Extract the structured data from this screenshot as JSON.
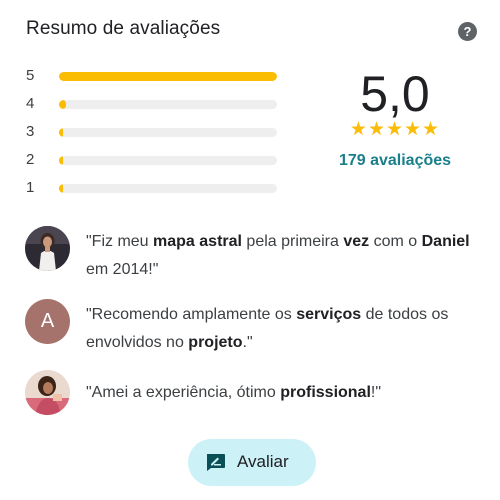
{
  "header": {
    "title": "Resumo de avaliações",
    "help_icon": "help-circle-icon",
    "help_glyph": "?"
  },
  "rating_distribution": {
    "bar_color": "#fbbc04",
    "track_color": "#eeeeef",
    "rows": [
      {
        "stars": "5",
        "fraction": 1.0
      },
      {
        "stars": "4",
        "fraction": 0.03
      },
      {
        "stars": "3",
        "fraction": 0.01
      },
      {
        "stars": "2",
        "fraction": 0.01
      },
      {
        "stars": "1",
        "fraction": 0.01
      }
    ]
  },
  "summary": {
    "score": "5,0",
    "stars": "★★★★★",
    "star_rating": 5,
    "review_count_label": "179 avaliações",
    "link_color": "#1a7f8a"
  },
  "reviews": [
    {
      "avatar": "photo",
      "quote": [
        {
          "text": "\"Fiz meu ",
          "bold": false
        },
        {
          "text": "mapa astral",
          "bold": true
        },
        {
          "text": " pela primeira ",
          "bold": false
        },
        {
          "text": "vez",
          "bold": true
        },
        {
          "text": " com o ",
          "bold": false
        },
        {
          "text": "Daniel",
          "bold": true
        },
        {
          "text": " em 2014!\"",
          "bold": false
        }
      ]
    },
    {
      "avatar": "letter",
      "avatar_letter": "A",
      "avatar_color": "#a5736b",
      "quote": [
        {
          "text": "\"Recomendo amplamente os ",
          "bold": false
        },
        {
          "text": "serviços",
          "bold": true
        },
        {
          "text": " de todos os envolvidos no ",
          "bold": false
        },
        {
          "text": "projeto",
          "bold": true
        },
        {
          "text": ".\"",
          "bold": false
        }
      ]
    },
    {
      "avatar": "photo",
      "quote": [
        {
          "text": "\"Amei a experiência, ótimo ",
          "bold": false
        },
        {
          "text": "profissional",
          "bold": true
        },
        {
          "text": "!\"",
          "bold": false
        }
      ]
    }
  ],
  "write_review": {
    "label": "Avaliar",
    "icon": "rate-review-icon",
    "bg_color": "#ccf1f7"
  }
}
